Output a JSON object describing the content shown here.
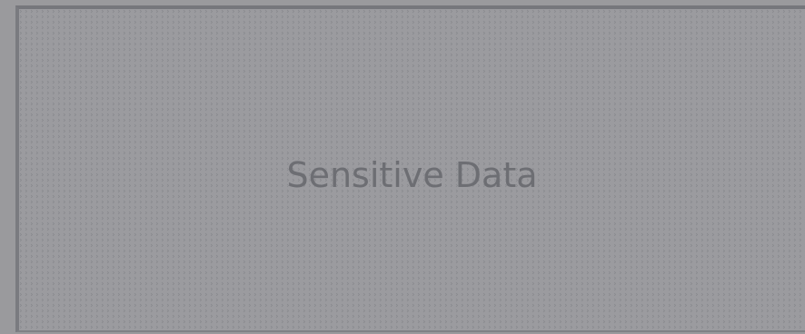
{
  "redaction": {
    "label": "Sensitive Data"
  },
  "colors": {
    "background": "#9a9a9d",
    "panel_fill": "#9b9b9f",
    "panel_border": "#76777c",
    "pattern": "#86878c",
    "label_text": "#6d6e73"
  }
}
